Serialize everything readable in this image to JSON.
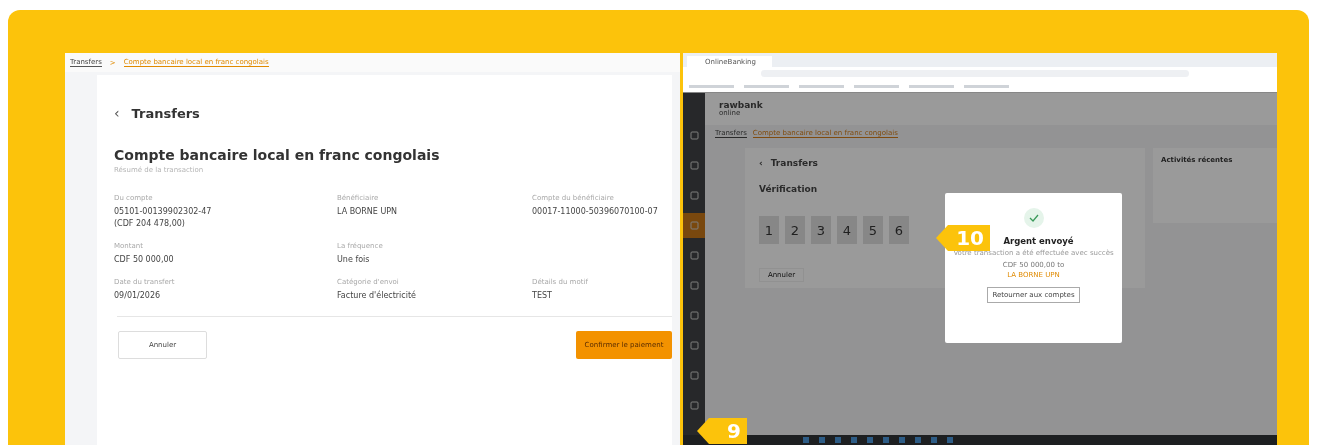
{
  "left_screenshot": {
    "breadcrumb": [
      "Transfers",
      "Compte bancaire local en franc congolais"
    ],
    "breadcrumb_separator": ">",
    "back_icon": "‹",
    "back_title": "Transfers",
    "title": "Compte bancaire local en franc congolais",
    "subtitle": "Résumé de la transaction",
    "fields": [
      {
        "label": "Du compte",
        "value": "05101-00139902302-47\n(CDF 204 478,00)"
      },
      {
        "label": "Bénéficiaire",
        "value": "LA BORNE UPN"
      },
      {
        "label": "Compte du bénéficiaire",
        "value": "00017-11000-50396070100-07"
      },
      {
        "label": "Montant",
        "value": "CDF 50 000,00"
      },
      {
        "label": "La fréquence",
        "value": "Une fois"
      },
      {
        "label": "Date du transfert",
        "value": "09/01/2026"
      },
      {
        "label": "Catégorie d'envoi",
        "value": "Facture d'électricité"
      },
      {
        "label": "Détails du motif",
        "value": "TEST"
      }
    ],
    "buttons": [
      {
        "kind": "secondary",
        "label": "Annuler"
      },
      {
        "kind": "primary",
        "label": "Confirmer le paiement"
      }
    ]
  },
  "right_screenshot": {
    "tab_title": "OnlineBanking",
    "logo": "rawbank",
    "logo_sub": "online",
    "sidebar_items": [
      {
        "selected": false
      },
      {
        "selected": false
      },
      {
        "selected": false
      },
      {
        "selected": true
      },
      {
        "selected": false
      },
      {
        "selected": false
      },
      {
        "selected": false
      },
      {
        "selected": false
      },
      {
        "selected": false
      },
      {
        "selected": false
      }
    ],
    "breadcrumb": [
      "Transfers",
      "Compte bancaire local en franc congolais"
    ],
    "back_icon": "‹",
    "back_title": "Transfers",
    "section_title": "Vérification",
    "code_digits": [
      "1",
      "2",
      "3",
      "4",
      "5",
      "6"
    ],
    "cancel": "Annuler",
    "recent_title": "Activités récentes",
    "modal": {
      "title": "Argent envoyé",
      "message": "Votre transaction a été effectuée avec succès",
      "amount": "CDF 50 000,00 to",
      "recipient": "LA BORNE UPN",
      "button": "Retourner aux comptes"
    }
  },
  "step_badges": [
    {
      "number": "9"
    },
    {
      "number": "10"
    }
  ]
}
